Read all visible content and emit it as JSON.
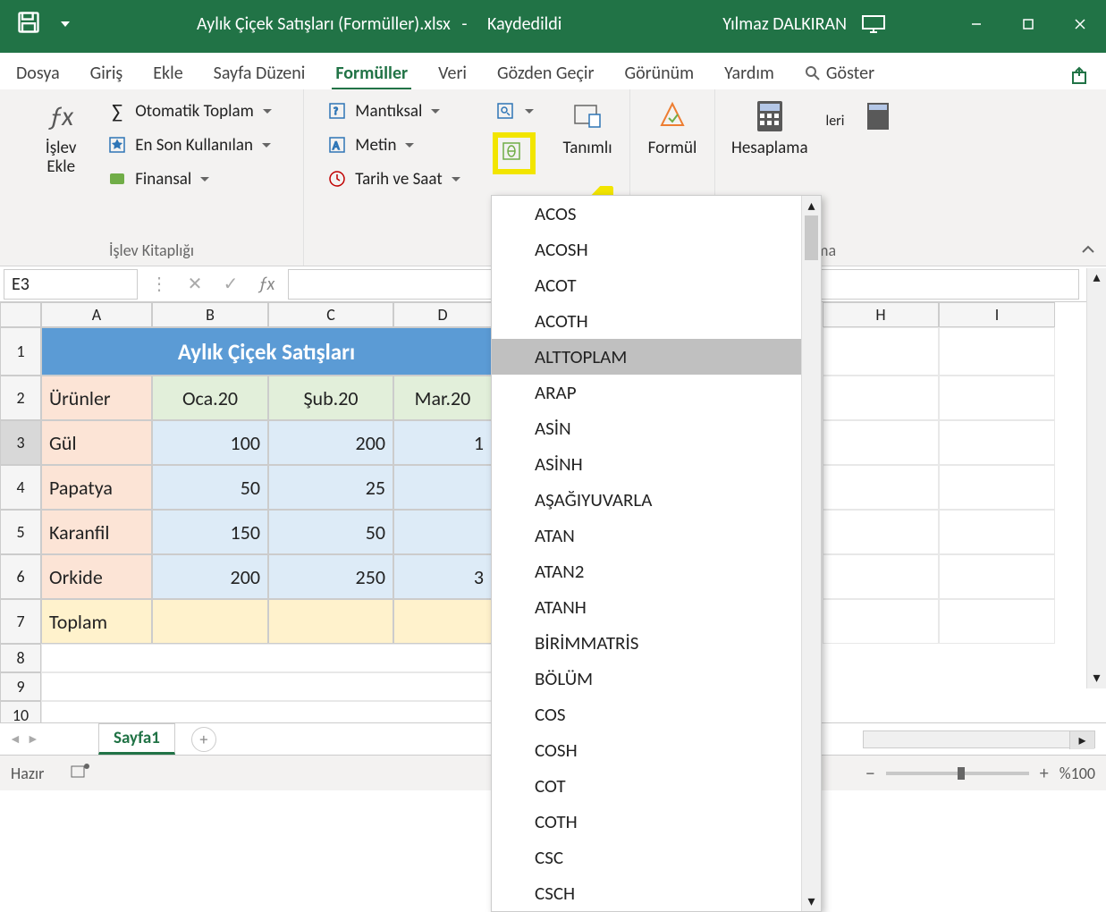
{
  "titlebar": {
    "filename": "Aylık Çiçek Satışları (Formüller).xlsx",
    "sep": "-",
    "saved": "Kaydedildi",
    "user": "Yılmaz DALKIRAN"
  },
  "tabs": {
    "file": "Dosya",
    "home": "Giriş",
    "insert": "Ekle",
    "layout": "Sayfa Düzeni",
    "formulas": "Formüller",
    "data": "Veri",
    "review": "Gözden Geçir",
    "view": "Görünüm",
    "help": "Yardım",
    "tellme": "Göster"
  },
  "ribbon": {
    "insert_func": "İşlev Ekle",
    "autosum": "Otomatik Toplam",
    "recent": "En Son Kullanılan",
    "financial": "Finansal",
    "logical": "Mantıksal",
    "text": "Metin",
    "datetime": "Tarih ve Saat",
    "defined": "Tanımlı",
    "formula": "Formül",
    "calculation": "Hesaplama",
    "options_suffix": "leri",
    "right_label": "aplama",
    "group_lib": "İşlev Kitaplığı"
  },
  "namebox": "E3",
  "sheet": {
    "title_row": "Aylık Çiçek Satışları",
    "headers": {
      "A": "Ürünler",
      "B": "Oca.20",
      "C": "Şub.20",
      "D": "Mar.20"
    },
    "rows": [
      {
        "name": "Gül",
        "b": "100",
        "c": "200",
        "d": "1"
      },
      {
        "name": "Papatya",
        "b": "50",
        "c": "25",
        "d": ""
      },
      {
        "name": "Karanfil",
        "b": "150",
        "c": "50",
        "d": ""
      },
      {
        "name": "Orkide",
        "b": "200",
        "c": "250",
        "d": "3"
      }
    ],
    "total_label": "Toplam"
  },
  "cols": {
    "A": "A",
    "B": "B",
    "C": "C",
    "D": "D",
    "H": "H",
    "I": "I"
  },
  "rownums": [
    "1",
    "2",
    "3",
    "4",
    "5",
    "6",
    "7",
    "8",
    "9",
    "10"
  ],
  "func_menu": {
    "items": [
      "ACOS",
      "ACOSH",
      "ACOT",
      "ACOTH",
      "ALTTOPLAM",
      "ARAP",
      "ASİN",
      "ASİNH",
      "AŞAĞIYUVARLA",
      "ATAN",
      "ATAN2",
      "ATANH",
      "BİRİMMATRİS",
      "BÖLÜM",
      "COS",
      "COSH",
      "COT",
      "COTH",
      "CSC",
      "CSCH"
    ],
    "selected": "ALTTOPLAM"
  },
  "sheettab": "Sayfa1",
  "status": {
    "ready": "Hazır",
    "zoom": "%100"
  }
}
